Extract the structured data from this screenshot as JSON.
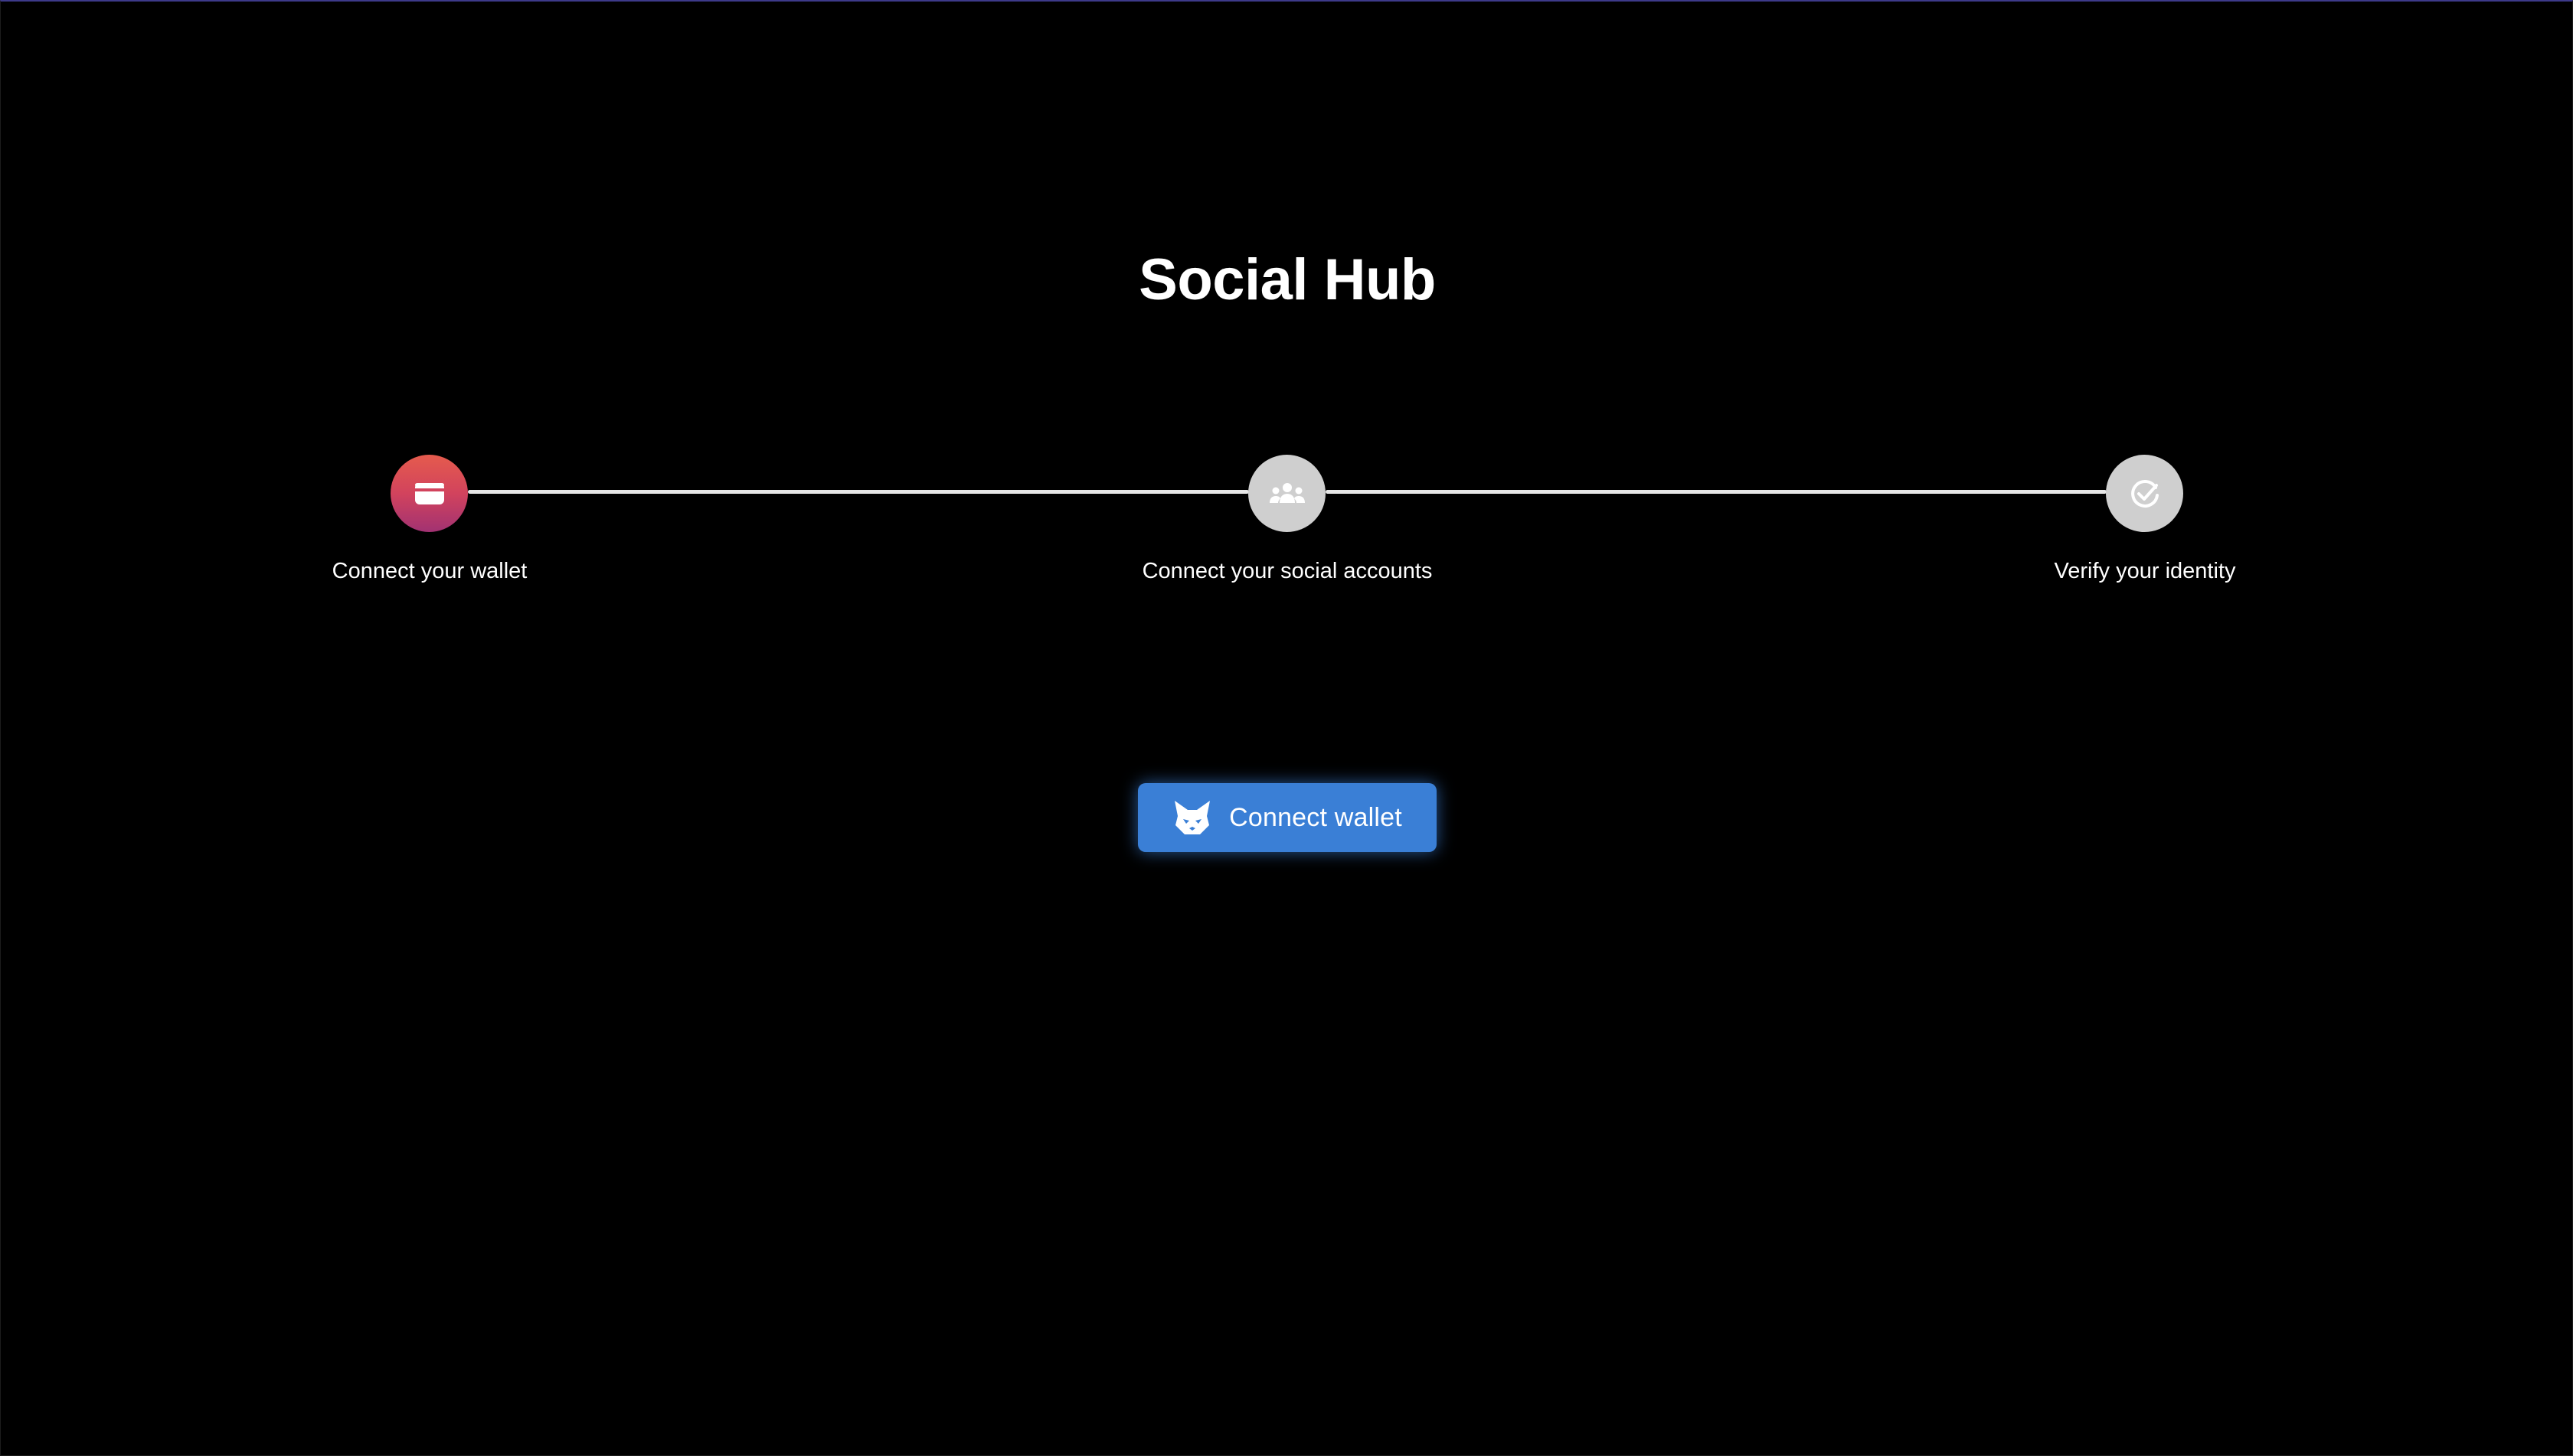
{
  "app": {
    "title": "Social Hub"
  },
  "stepper": {
    "steps": [
      {
        "label": "Connect your wallet",
        "icon": "wallet-icon",
        "state": "active"
      },
      {
        "label": "Connect your social accounts",
        "icon": "group-icon",
        "state": "inactive"
      },
      {
        "label": "Verify your identity",
        "icon": "check-circle-icon",
        "state": "inactive"
      }
    ]
  },
  "actions": {
    "connect_wallet": {
      "label": "Connect wallet",
      "icon": "fox-icon"
    }
  },
  "colors": {
    "background": "#000000",
    "active_gradient_start": "#e55b4d",
    "active_gradient_end": "#a23272",
    "inactive_step": "#cfcfcf",
    "connector": "#e6e6e6",
    "button": "#3a7fd6",
    "text": "#ffffff"
  }
}
